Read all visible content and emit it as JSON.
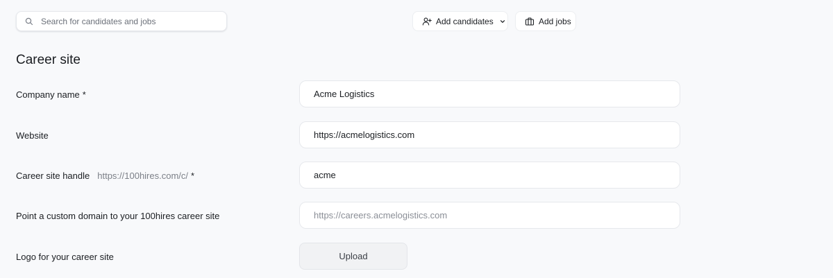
{
  "search": {
    "placeholder": "Search for candidates and jobs",
    "icon": "search-icon"
  },
  "toolbar": {
    "add_candidates_label": "Add candidates",
    "add_candidates_icon": "user-plus-icon",
    "add_jobs_label": "Add jobs",
    "add_jobs_icon": "briefcase-icon"
  },
  "page": {
    "title": "Career site"
  },
  "form": {
    "company_name": {
      "label": "Company name",
      "required_mark": "*",
      "value": "Acme Logistics"
    },
    "website": {
      "label": "Website",
      "value": "https://acmelogistics.com"
    },
    "handle": {
      "label": "Career site handle",
      "prefix_hint": "https://100hires.com/c/",
      "required_mark": "*",
      "value": "acme"
    },
    "custom_domain": {
      "label": "Point a custom domain to your 100hires career site",
      "value": "",
      "placeholder": "https://careers.acmelogistics.com"
    },
    "logo": {
      "label": "Logo for your career site",
      "button_label": "Upload"
    }
  }
}
